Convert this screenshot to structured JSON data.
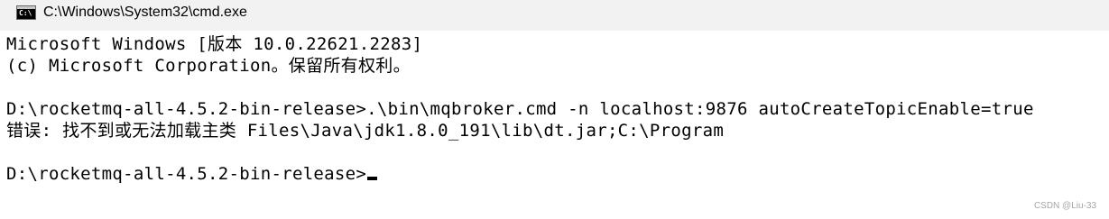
{
  "window": {
    "title": "C:\\Windows\\System32\\cmd.exe",
    "icon": "cmd-prompt-icon",
    "icon_text": "C:\\"
  },
  "console": {
    "lines": [
      "Microsoft Windows [版本 10.0.22621.2283]",
      "(c) Microsoft Corporation。保留所有权利。",
      "",
      "D:\\rocketmq-all-4.5.2-bin-release>.\\bin\\mqbroker.cmd -n localhost:9876 autoCreateTopicEnable=true",
      "错误: 找不到或无法加载主类 Files\\Java\\jdk1.8.0_191\\lib\\dt.jar;C:\\Program",
      "",
      "D:\\rocketmq-all-4.5.2-bin-release>"
    ]
  },
  "watermark": "CSDN @Liu-33",
  "colors": {
    "titlebar_bg": "#f2f2f2",
    "console_bg": "#ffffff",
    "text": "#000000"
  }
}
